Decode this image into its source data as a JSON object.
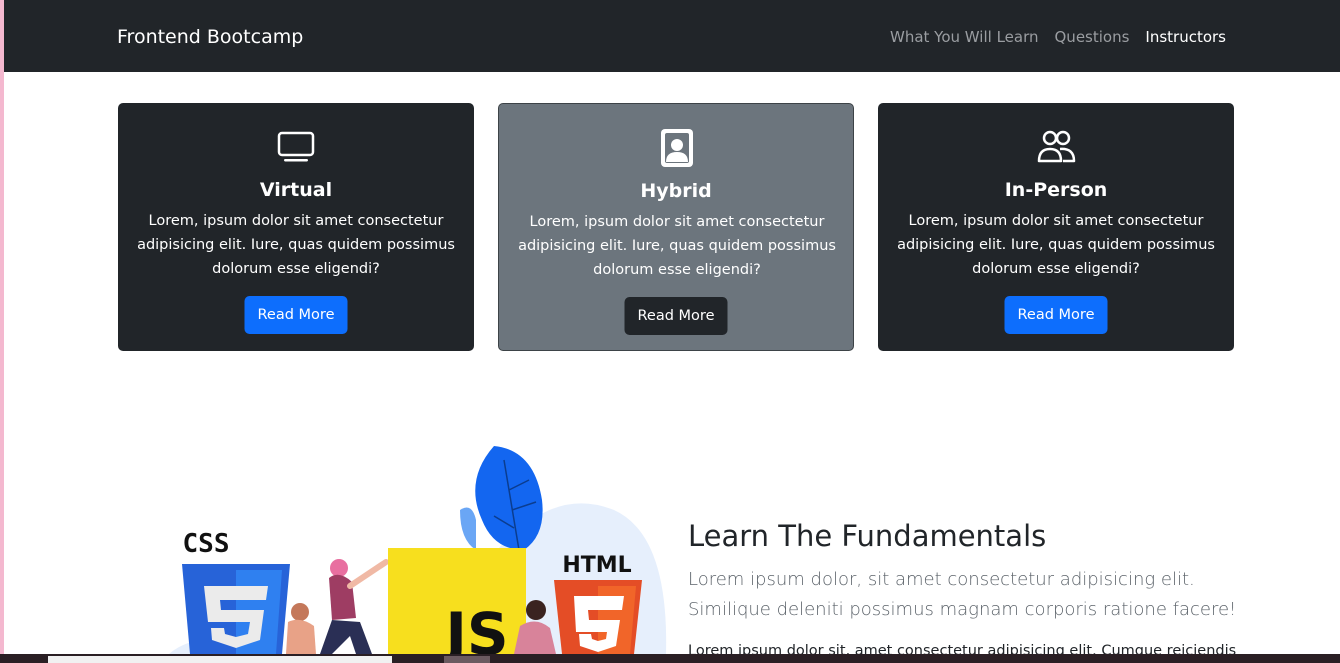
{
  "navbar": {
    "brand": "Frontend Bootcamp",
    "links": [
      {
        "label": "What You Will Learn",
        "active": false
      },
      {
        "label": "Questions",
        "active": false
      },
      {
        "label": "Instructors",
        "active": true
      }
    ]
  },
  "cards": [
    {
      "icon": "laptop-icon",
      "title": "Virtual",
      "text": "Lorem, ipsum dolor sit amet consectetur adipisicing elit. Iure, quas quidem possimus dolorum esse eligendi?",
      "button": "Read More",
      "theme": "dark"
    },
    {
      "icon": "person-badge-icon",
      "title": "Hybrid",
      "text": "Lorem, ipsum dolor sit amet consectetur adipisicing elit. Iure, quas quidem possimus dolorum esse eligendi?",
      "button": "Read More",
      "theme": "secondary"
    },
    {
      "icon": "people-icon",
      "title": "In-Person",
      "text": "Lorem, ipsum dolor sit amet consectetur adipisicing elit. Iure, quas quidem possimus dolorum esse eligendi?",
      "button": "Read More",
      "theme": "dark"
    }
  ],
  "learn": {
    "title": "Learn The Fundamentals",
    "lead": "Lorem ipsum dolor, sit amet consectetur adipisicing elit. Similique deleniti possimus magnam corporis ratione facere!",
    "paragraph": "Lorem ipsum dolor sit, amet consectetur adipisicing elit. Cumque reiciendis"
  },
  "illustration": {
    "css_label": "CSS",
    "html_label": "HTML",
    "js_label": "JS"
  },
  "colors": {
    "navbar": "#212529",
    "primary": "#0d6efd",
    "secondary": "#6c757d",
    "css_blue": "#2763d8",
    "html_orange": "#e44d26",
    "js_yellow": "#f7df1e"
  }
}
